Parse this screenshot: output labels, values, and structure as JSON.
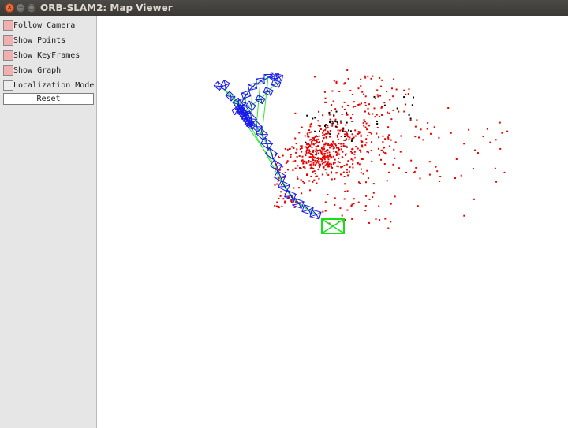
{
  "window": {
    "title": "ORB-SLAM2: Map Viewer",
    "controls": {
      "close": "×",
      "minimize": "−",
      "maximize": "□"
    }
  },
  "panel": {
    "options": [
      {
        "label": "Follow Camera",
        "checked": true
      },
      {
        "label": "Show Points",
        "checked": true
      },
      {
        "label": "Show KeyFrames",
        "checked": true
      },
      {
        "label": "Show Graph",
        "checked": true
      },
      {
        "label": "Localization Mode",
        "checked": false
      }
    ],
    "reset_label": "Reset"
  },
  "colors": {
    "map_point": "#e80000",
    "reference_point": "#000000",
    "keyframe": "#1a1aee",
    "graph_edge": "#2ee82e",
    "current_camera": "#18e018",
    "checkbox_checked": "#f0b0b0"
  }
}
